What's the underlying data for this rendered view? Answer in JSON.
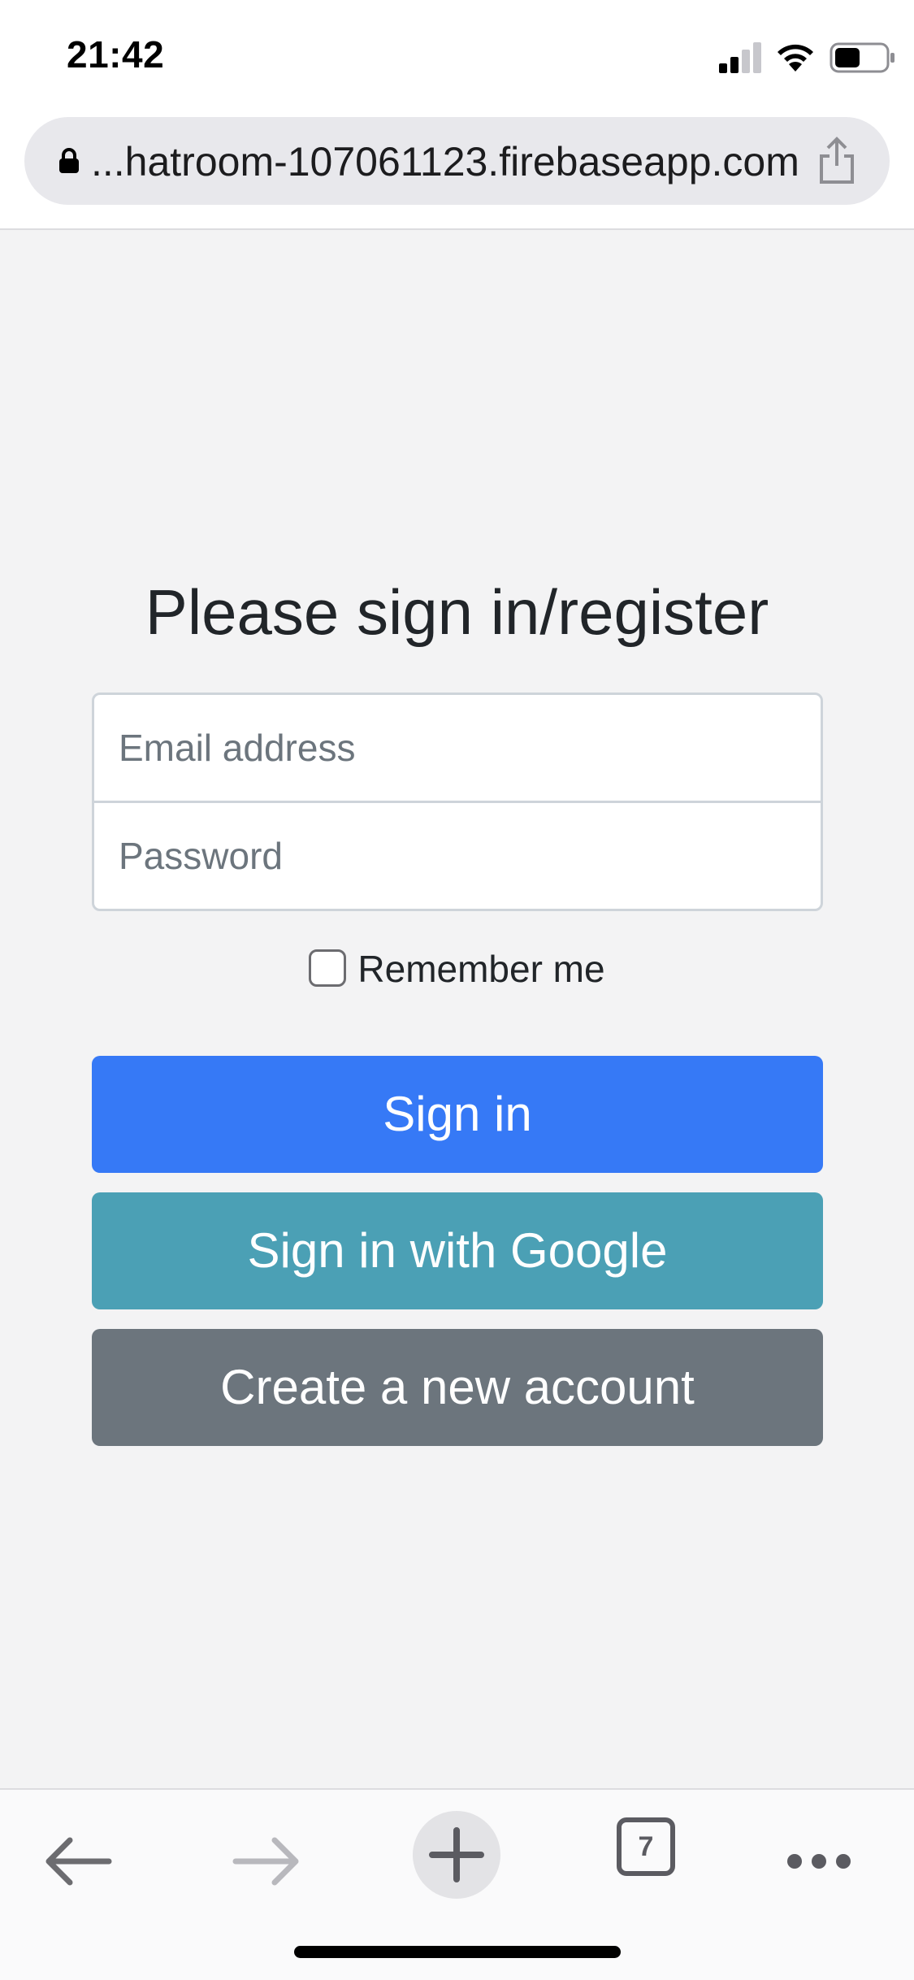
{
  "status_bar": {
    "time": "21:42",
    "icons": [
      "signal-icon",
      "wifi-icon",
      "battery-icon"
    ]
  },
  "browser": {
    "url": "...hatroom-107061123.firebaseapp.com",
    "icons": {
      "lock": "lock-icon",
      "share": "share-icon"
    }
  },
  "form": {
    "title": "Please sign in/register",
    "email_placeholder": "Email address",
    "password_placeholder": "Password",
    "remember_label": "Remember me",
    "remember_checked": false,
    "signin_label": "Sign in",
    "google_label": "Sign in with Google",
    "create_label": "Create a new account"
  },
  "colors": {
    "primary": "#3679f6",
    "info": "#4ba0b5",
    "secondary": "#6c757d",
    "background": "#f3f3f4"
  },
  "toolbar": {
    "tab_count": "7",
    "icons": [
      "back-arrow-icon",
      "forward-arrow-icon",
      "plus-icon",
      "tabs-icon",
      "more-icon"
    ]
  }
}
